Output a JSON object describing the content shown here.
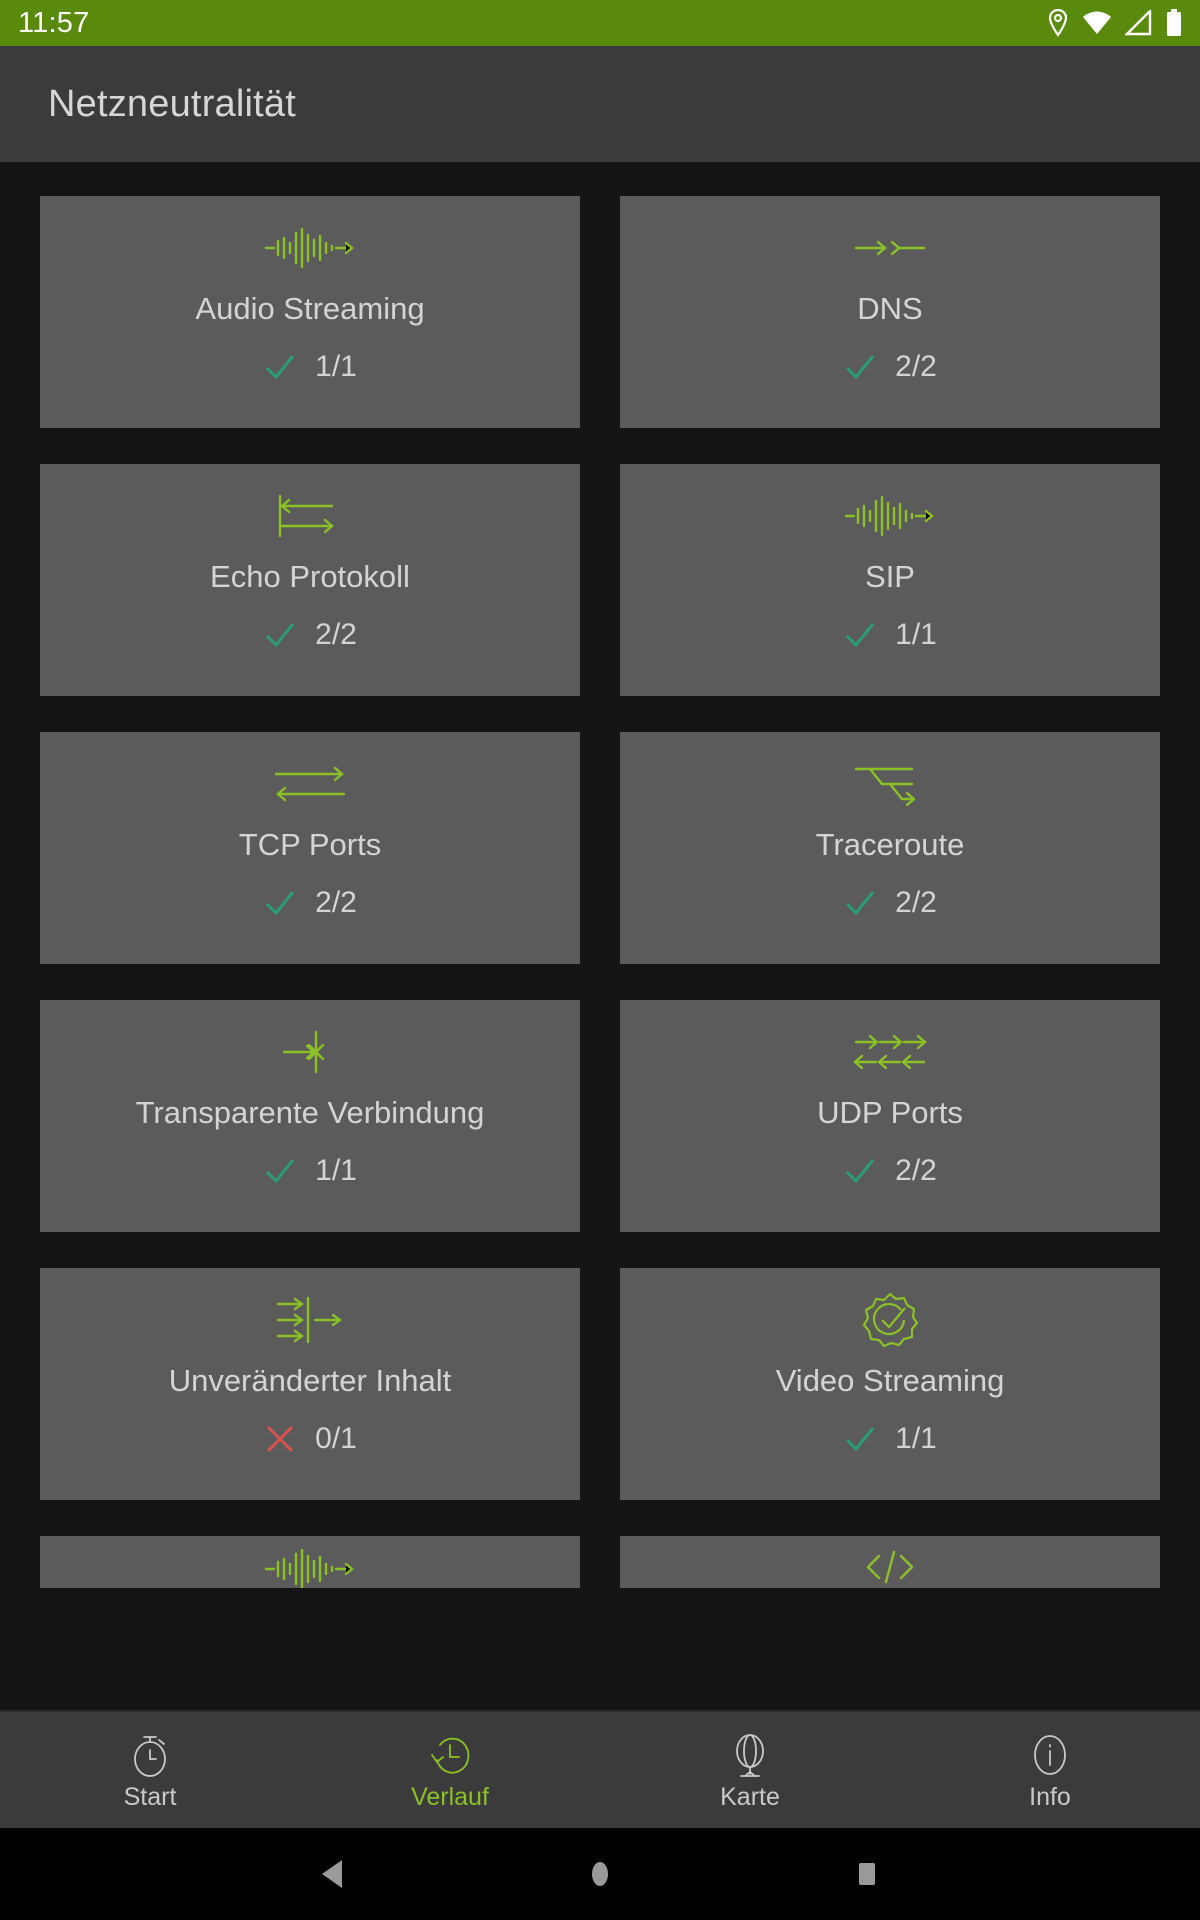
{
  "status_bar": {
    "clock": "11:57",
    "icons": [
      "location-pin-icon",
      "wifi-icon",
      "signal-icon",
      "battery-icon"
    ]
  },
  "app_bar": {
    "title": "Netzneutralität"
  },
  "colors": {
    "accent_green": "#8cc126",
    "status_bar_green": "#5a8a0c",
    "card_bg": "#5b5b5b",
    "page_bg": "#141414",
    "chrome_bg": "#3b3b3b",
    "check_teal": "#2a9d74",
    "cross_red": "#d9534f",
    "text_primary": "#d4d4d4"
  },
  "cards": [
    {
      "title": "Audio Streaming",
      "icon": "audio-waveform-arrow-icon",
      "result": "pass",
      "count": "1/1"
    },
    {
      "title": "DNS",
      "icon": "dns-arrow-icon",
      "result": "pass",
      "count": "2/2"
    },
    {
      "title": "Echo Protokoll",
      "icon": "echo-loopback-icon",
      "result": "pass",
      "count": "2/2"
    },
    {
      "title": "SIP",
      "icon": "audio-waveform-arrow-icon",
      "result": "pass",
      "count": "1/1"
    },
    {
      "title": "TCP Ports",
      "icon": "bidirectional-arrows-icon",
      "result": "pass",
      "count": "2/2"
    },
    {
      "title": "Traceroute",
      "icon": "traceroute-hops-icon",
      "result": "pass",
      "count": "2/2"
    },
    {
      "title": "Transparente Verbindung",
      "icon": "blocked-connection-icon",
      "result": "pass",
      "count": "1/1"
    },
    {
      "title": "UDP Ports",
      "icon": "udp-multi-arrows-icon",
      "result": "pass",
      "count": "2/2"
    },
    {
      "title": "Unveränderter Inhalt",
      "icon": "content-filter-icon",
      "result": "fail",
      "count": "0/1"
    },
    {
      "title": "Video Streaming",
      "icon": "verified-badge-icon",
      "result": "pass",
      "count": "1/1"
    }
  ],
  "partial_cards": [
    {
      "icon": "audio-waveform-arrow-icon"
    },
    {
      "icon": "code-tags-icon"
    }
  ],
  "bottom_nav": {
    "items": [
      {
        "label": "Start",
        "icon": "stopwatch-icon",
        "active": false
      },
      {
        "label": "Verlauf",
        "icon": "history-icon",
        "active": true
      },
      {
        "label": "Karte",
        "icon": "globe-icon",
        "active": false
      },
      {
        "label": "Info",
        "icon": "info-icon",
        "active": false
      }
    ]
  },
  "system_nav": {
    "buttons": [
      "back-triangle-icon",
      "home-circle-icon",
      "recents-square-icon"
    ]
  }
}
